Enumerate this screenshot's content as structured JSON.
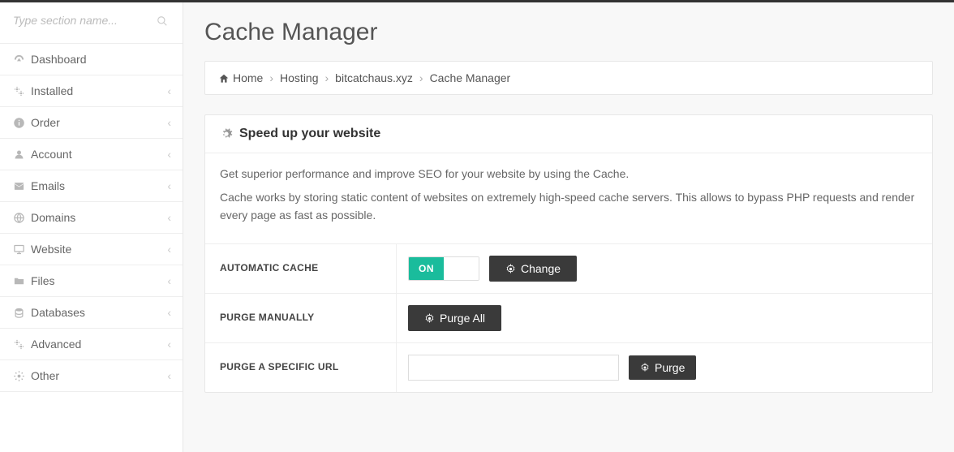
{
  "sidebar": {
    "search_placeholder": "Type section name...",
    "items": [
      {
        "label": "Dashboard",
        "icon": "gauge",
        "expandable": false
      },
      {
        "label": "Installed",
        "icon": "gears",
        "expandable": true
      },
      {
        "label": "Order",
        "icon": "info",
        "expandable": true
      },
      {
        "label": "Account",
        "icon": "user",
        "expandable": true
      },
      {
        "label": "Emails",
        "icon": "envelope",
        "expandable": true
      },
      {
        "label": "Domains",
        "icon": "globe",
        "expandable": true
      },
      {
        "label": "Website",
        "icon": "monitor",
        "expandable": true
      },
      {
        "label": "Files",
        "icon": "folder",
        "expandable": true
      },
      {
        "label": "Databases",
        "icon": "database",
        "expandable": true
      },
      {
        "label": "Advanced",
        "icon": "gears",
        "expandable": true
      },
      {
        "label": "Other",
        "icon": "gear",
        "expandable": true
      }
    ]
  },
  "page": {
    "title": "Cache Manager"
  },
  "breadcrumb": [
    {
      "label": "Home",
      "icon": "home"
    },
    {
      "label": "Hosting"
    },
    {
      "label": "bitcatchaus.xyz"
    },
    {
      "label": "Cache Manager"
    }
  ],
  "panel": {
    "heading": "Speed up your website",
    "para1": "Get superior performance and improve SEO for your website by using the Cache.",
    "para2": "Cache works by storing static content of websites on extremely high-speed cache servers. This allows to bypass PHP requests and render every page as fast as possible."
  },
  "rows": {
    "auto_cache": {
      "label": "Automatic Cache",
      "state": "ON",
      "button": "Change"
    },
    "purge_manual": {
      "label": "Purge Manually",
      "button": "Purge All"
    },
    "purge_url": {
      "label": "Purge a Specific URL",
      "button": "Purge",
      "value": ""
    }
  }
}
